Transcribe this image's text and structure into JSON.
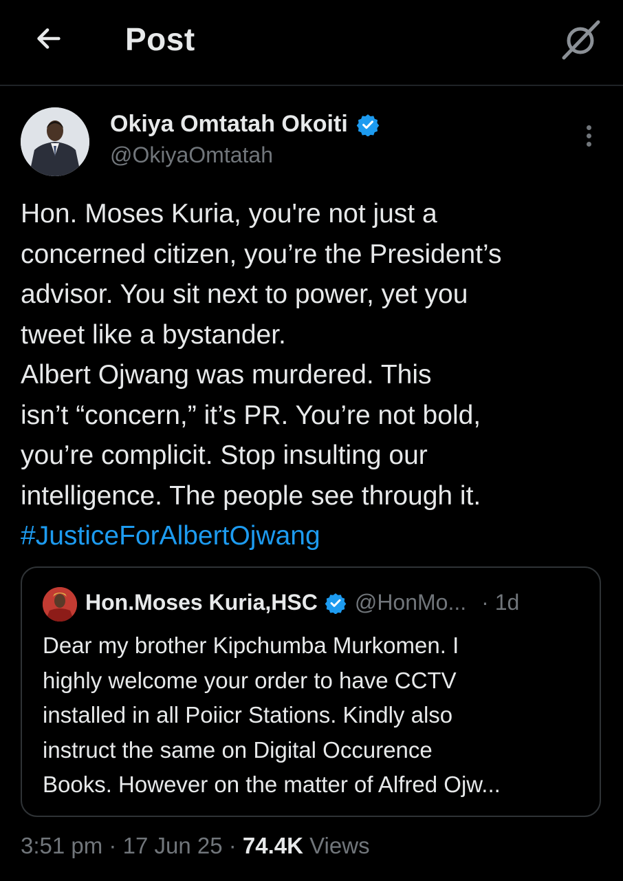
{
  "header": {
    "title": "Post",
    "back_icon": "arrow-left-icon",
    "grok_icon": "grok-icon"
  },
  "author": {
    "name": "Okiya Omtatah Okoiti",
    "handle": "@OkiyaOmtatah",
    "verified": true
  },
  "post": {
    "lines": [
      "Hon. Moses Kuria, you're not just a",
      "concerned citizen, you’re the President’s",
      "advisor. You sit next to power, yet you",
      "tweet like a bystander.",
      "Albert Ojwang was murdered. This",
      "isn’t “concern,” it’s PR. You’re not bold,",
      "you’re complicit. Stop insulting our",
      "intelligence. The people see through it."
    ],
    "hashtag": "#JusticeForAlbertOjwang"
  },
  "quote": {
    "name": "Hon.Moses Kuria,HSC",
    "handle": "@HonMo...",
    "time": "· 1d",
    "lines": [
      "Dear my brother Kipchumba Murkomen. I",
      "highly welcome your order to have CCTV",
      "installed in all Poiicr Stations. Kindly also",
      "instruct the same on Digital Occurence",
      "Books. However on the matter of Alfred Ojw..."
    ]
  },
  "meta": {
    "time": "3:51 pm",
    "date": "17 Jun 25",
    "views_count": "74.4K",
    "views_label": "Views"
  },
  "colors": {
    "background": "#000000",
    "text": "#e7e9ea",
    "secondary": "#71767b",
    "accent": "#1d9bf0"
  }
}
